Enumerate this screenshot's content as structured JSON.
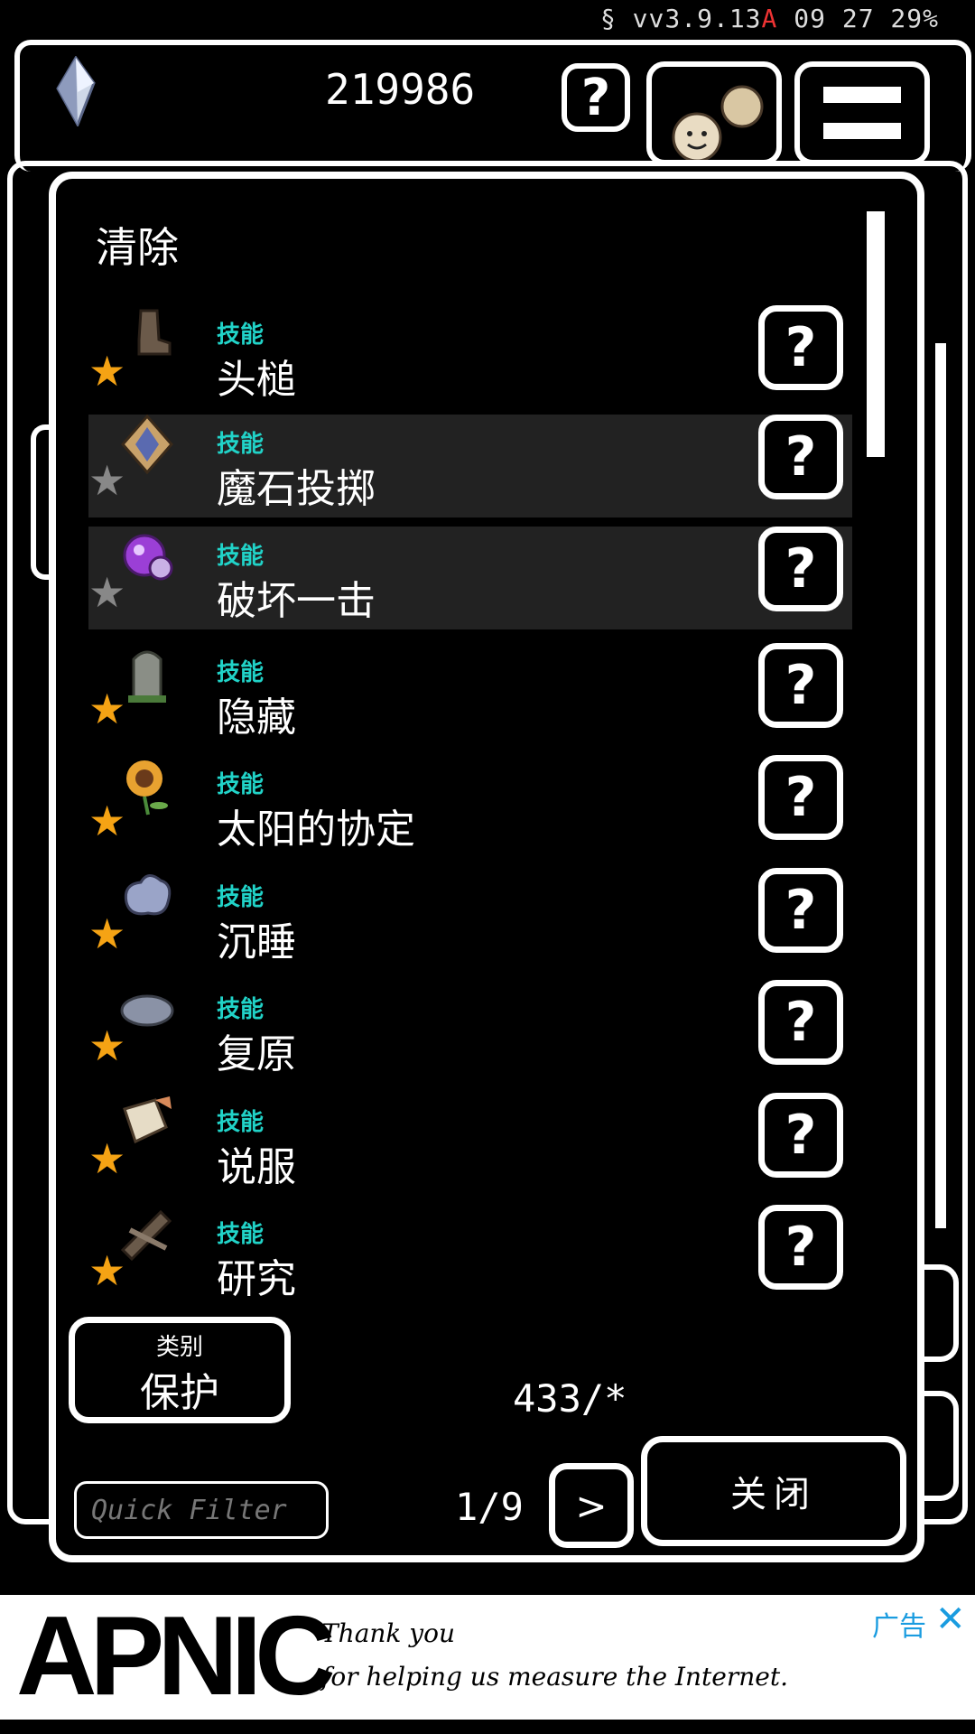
{
  "status": {
    "prefix": "§ vv3.9.13",
    "alert": "A",
    "time": "09 27",
    "battery": "29%"
  },
  "hud": {
    "currency": "219986",
    "help_label": "?",
    "currency_icon": "crystal-icon",
    "avatar_icon": "character-avatar-icon",
    "menu_icon": "hamburger-menu-icon"
  },
  "dialog": {
    "title": "清除",
    "items": [
      {
        "type": "技能",
        "name": "头槌",
        "star": "★",
        "star_color": "#f5a314",
        "icon": "boot-icon",
        "highlight": false,
        "help": "?"
      },
      {
        "type": "技能",
        "name": "魔石投掷",
        "star": "★",
        "star_color": "#888888",
        "icon": "magic-stone-icon",
        "highlight": true,
        "help": "?"
      },
      {
        "type": "技能",
        "name": "破坏一击",
        "star": "★",
        "star_color": "#888888",
        "icon": "purple-orb-icon",
        "highlight": true,
        "help": "?"
      },
      {
        "type": "技能",
        "name": "隐藏",
        "star": "★",
        "star_color": "#f5a314",
        "icon": "gravestone-icon",
        "highlight": false,
        "help": "?"
      },
      {
        "type": "技能",
        "name": "太阳的协定",
        "star": "★",
        "star_color": "#f5a314",
        "icon": "sunflower-icon",
        "highlight": false,
        "help": "?"
      },
      {
        "type": "技能",
        "name": "沉睡",
        "star": "★",
        "star_color": "#f5a314",
        "icon": "sleep-cloud-icon",
        "highlight": false,
        "help": "?"
      },
      {
        "type": "技能",
        "name": "复原",
        "star": "★",
        "star_color": "#f5a314",
        "icon": "stone-icon",
        "highlight": false,
        "help": "?"
      },
      {
        "type": "技能",
        "name": "说服",
        "star": "★",
        "star_color": "#f5a314",
        "icon": "scroll-icon",
        "highlight": false,
        "help": "?"
      },
      {
        "type": "技能",
        "name": "研究",
        "star": "★",
        "star_color": "#f5a314",
        "icon": "research-tools-icon",
        "highlight": false,
        "help": "?"
      }
    ],
    "category_label": "类别",
    "category_value": "保护",
    "count": "433/*",
    "quick_filter_placeholder": "Quick Filter",
    "page": "1/9",
    "next_label": ">",
    "close_label": "关闭"
  },
  "ad": {
    "logo": "APNIC",
    "line1": "Thank you",
    "line2": "for helping us measure the Internet.",
    "label": "广告",
    "close": "✕",
    "color": "#1a9ce0"
  },
  "colors": {
    "skill_type": "#21d3c8",
    "star_gold": "#f5a314",
    "star_gray": "#888888",
    "highlight_row": "#222222"
  }
}
